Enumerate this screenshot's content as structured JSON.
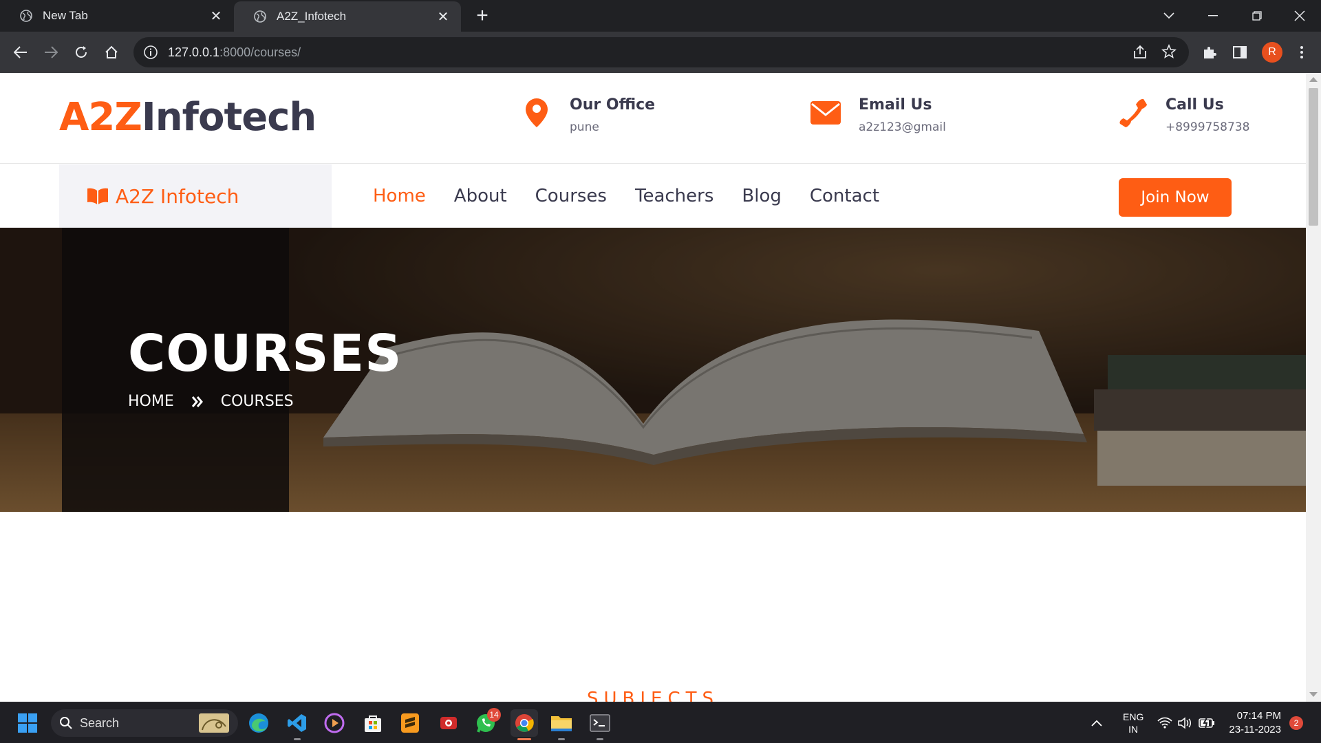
{
  "browser": {
    "tabs": [
      {
        "label": "New Tab",
        "icon": "globe-icon"
      },
      {
        "label": "A2Z_Infotech",
        "icon": "globe-icon"
      }
    ],
    "url_host": "127.0.0.1",
    "url_path": ":8000/courses/",
    "profile_initial": "R"
  },
  "site": {
    "brand_accent": "A2Z",
    "brand_rest": "Infotech",
    "colors": {
      "accent": "#fe5d14",
      "dark": "#3a3a4e"
    },
    "contacts": [
      {
        "title": "Our Office",
        "value": "pune",
        "icon": "map-pin-icon"
      },
      {
        "title": "Email Us",
        "value": "a2z123@gmail",
        "icon": "envelope-icon"
      },
      {
        "title": "Call Us",
        "value": "+8999758738",
        "icon": "phone-icon"
      }
    ],
    "nav_brand": "A2Z Infotech",
    "nav": [
      "Home",
      "About",
      "Courses",
      "Teachers",
      "Blog",
      "Contact"
    ],
    "join_label": "Join Now"
  },
  "hero": {
    "title": "COURSES",
    "crumb_home": "HOME",
    "crumb_current": "COURSES"
  },
  "section": {
    "subjects_heading": "SUBJECTS"
  },
  "taskbar": {
    "search_label": "Search",
    "whatsapp_badge": "14",
    "lang_top": "ENG",
    "lang_bottom": "IN",
    "time": "07:14 PM",
    "date": "23-11-2023",
    "notification_count": "2"
  }
}
